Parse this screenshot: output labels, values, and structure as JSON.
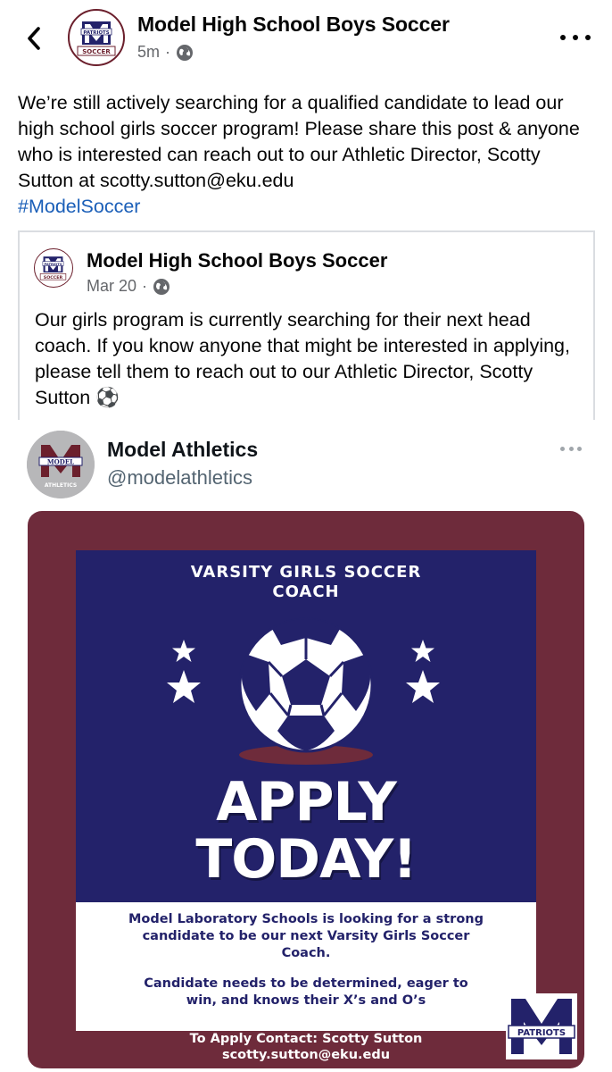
{
  "header": {
    "page_name": "Model High School Boys Soccer",
    "time": "5m",
    "separator": "·",
    "avatar_text_top": "PATRIOTS",
    "avatar_text_bottom": "SOCCER"
  },
  "post": {
    "text": "We’re still actively searching for a qualified candidate to lead our high school girls soccer program! Please share this post & anyone who is interested can reach out to our Athletic Director, Scotty Sutton at scotty.sutton@eku.edu",
    "hashtag": "#ModelSoccer"
  },
  "shared": {
    "page_name": "Model High School Boys Soccer",
    "date": "Mar 20",
    "separator": "·",
    "text": "Our girls program is currently searching for their next head coach. If you know anyone that might be interested in applying, please tell them to reach out to our Athletic Director, Scotty Sutton ⚽"
  },
  "tweet": {
    "name": "Model Athletics",
    "handle": "@modelathletics",
    "avatar_text_model": "MODEL",
    "avatar_text_athletics": "ATHLETICS"
  },
  "flyer": {
    "title_line1": "VARSITY GIRLS SOCCER",
    "title_line2": "COACH",
    "apply_line1": "APPLY",
    "apply_line2": "TODAY!",
    "info_line1": "Model Laboratory Schools is looking for a strong",
    "info_line2": "candidate to be our next Varsity Girls Soccer",
    "info_line3": "Coach.",
    "info_line4": "Candidate needs to be determined, eager to",
    "info_line5": "win, and knows their X’s and O’s",
    "contact_line1": "To Apply Contact: Scotty Sutton",
    "contact_line2": "scotty.sutton@eku.edu",
    "logo_text": "PATRIOTS"
  },
  "icons": {
    "back": "chevron-left-icon",
    "globe": "globe-icon",
    "more": "more-horizontal-icon",
    "soccer_ball": "soccer-ball-icon",
    "star": "star-icon"
  },
  "colors": {
    "maroon": "#6e2b3b",
    "navy": "#23226a",
    "link": "#1b5fb8",
    "secondary_text": "#65676b"
  }
}
